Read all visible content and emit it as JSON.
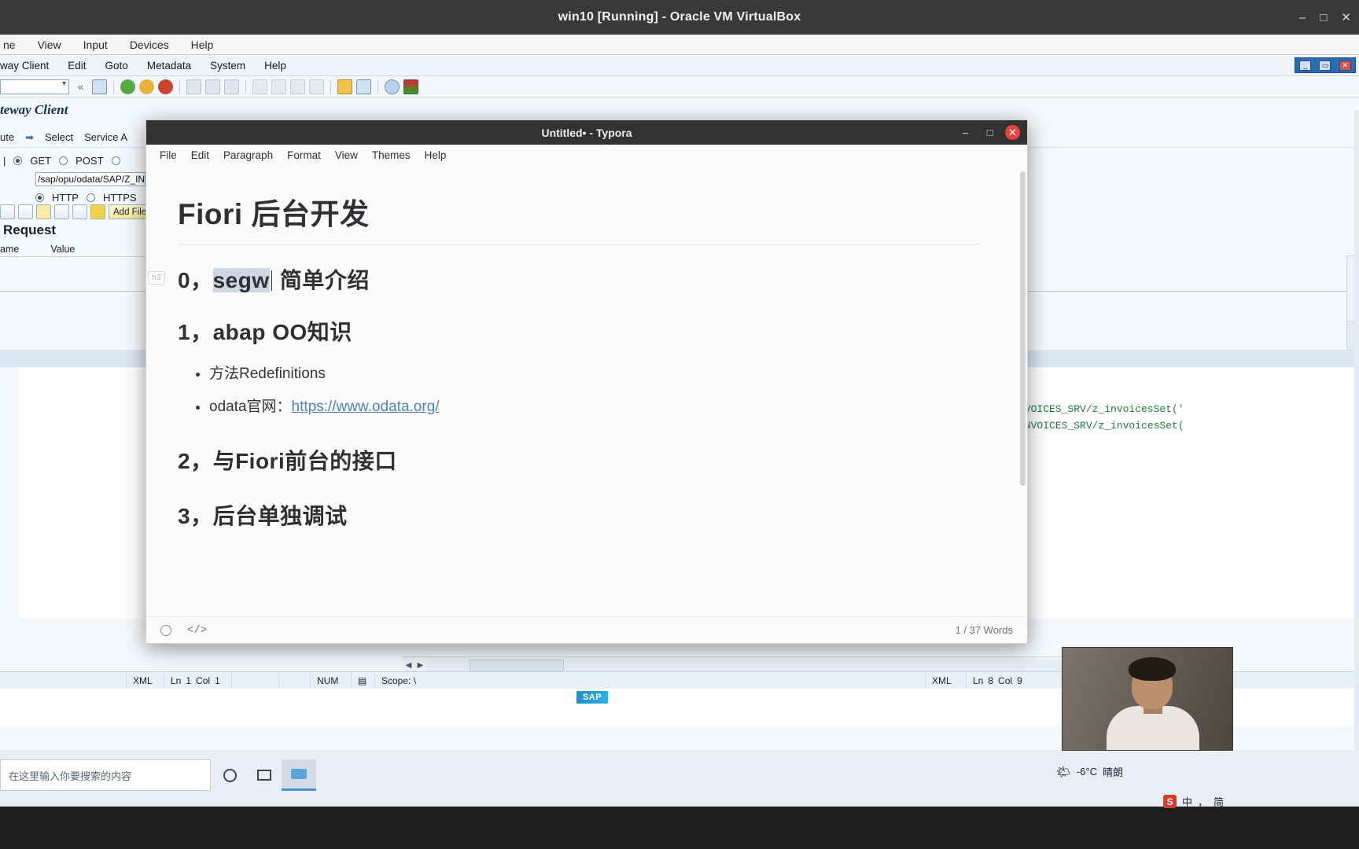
{
  "vbox": {
    "title": "win10 [Running] - Oracle VM VirtualBox",
    "menu": [
      "ne",
      "View",
      "Input",
      "Devices",
      "Help"
    ],
    "window_controls": [
      "–",
      "□",
      "✕"
    ]
  },
  "sap": {
    "menu": [
      "way Client",
      "Edit",
      "Goto",
      "Metadata",
      "System",
      "Help"
    ],
    "app_title": "teway Client",
    "subbar": [
      "ute",
      "Select",
      "Service A"
    ],
    "command_field": "",
    "http_methods": {
      "get": "GET",
      "post": "POST",
      "extra": ""
    },
    "url_value": "/sap/opu/odata/SAP/Z_INV",
    "protocols": {
      "http": "HTTP",
      "https": "HTTPS"
    },
    "add_file_label": "Add File",
    "request_title": "Request",
    "request_headers": [
      "ame",
      "Value"
    ],
    "response_lines": [
      "NVOICES_SRV/z_invoicesSet('",
      "INVOICES_SRV/z_invoicesSet("
    ],
    "statusbar": {
      "xml_left": "XML",
      "ln_left": "Ln",
      "ln_left_value": "1",
      "col_left": "Col",
      "col_left_value": "1",
      "num": "NUM",
      "scope_label": "Scope: \\",
      "xml_right": "XML",
      "ln_right": "Ln",
      "ln_right_value": "8",
      "col_right": "Col",
      "col_right_value": "9"
    },
    "logo": "SAP"
  },
  "typora": {
    "title": "Untitled• - Typora",
    "window_controls": {
      "minimize": "–",
      "maximize": "□",
      "close": "✕"
    },
    "menu": [
      "File",
      "Edit",
      "Paragraph",
      "Format",
      "View",
      "Themes",
      "Help"
    ],
    "document": {
      "h1": "Fiori 后台开发",
      "h3_marker": "h3",
      "h3_line": {
        "prefix": "0，",
        "selected": "segw",
        "suffix": " 简单介绍"
      },
      "h3_second": "1，abap OO知识",
      "bullets": [
        {
          "text": "方法Redefinitions",
          "link_prefix": "",
          "link": "",
          "link_text": ""
        },
        {
          "text": "odata官网：",
          "link_prefix": "odata官网：",
          "link_text": "https://www.odata.org/"
        }
      ],
      "h3_third": "2，与Fiori前台的接口",
      "h3_fourth": "3，后台单独调试"
    },
    "statusbar": {
      "source_toggle": "</>",
      "word_count": "1 / 37 Words"
    }
  },
  "taskbar": {
    "search_placeholder": "在这里输入你要搜索的内容",
    "buttons": [
      "cortana-icon",
      "task-view-icon",
      "typora-icon"
    ],
    "weather": {
      "temperature": "-6°C",
      "condition": "晴朗"
    },
    "ime": {
      "badge": "S",
      "lang": "中",
      "mode": "，",
      "extra": "简"
    }
  },
  "colors": {
    "vbox_titlebar": "#3b383c",
    "typora_titlebar": "#333232",
    "close_button": "#e8443b",
    "link": "#4a83b8",
    "selection": "#cdd7e3",
    "response_text": "#1e7a3c",
    "sap_blue": "#2b6cb0"
  }
}
